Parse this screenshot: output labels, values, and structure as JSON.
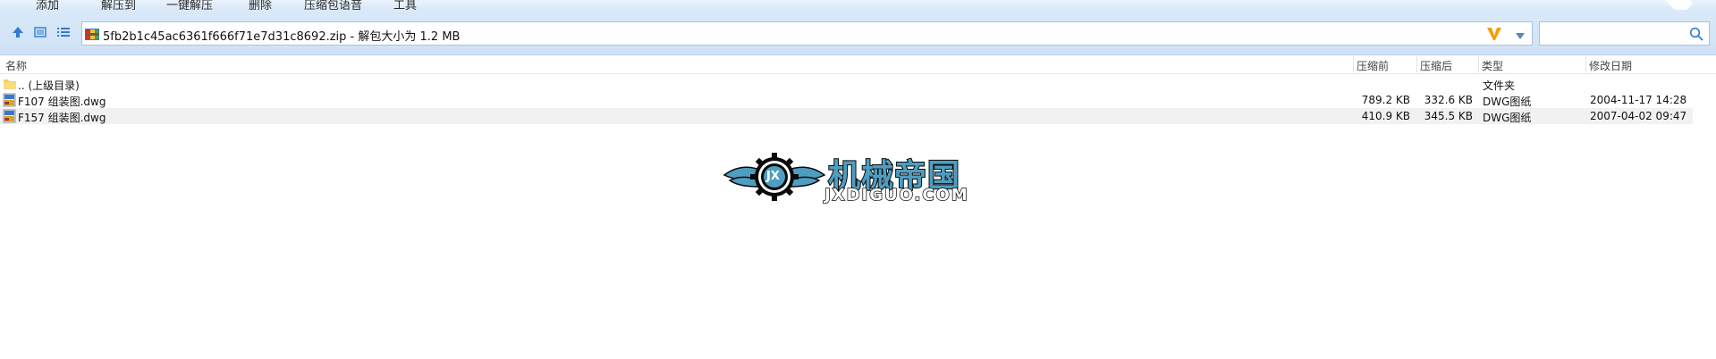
{
  "toolbar": {
    "items": [
      "添加",
      "解压到",
      "一键解压",
      "删除",
      "压缩包语音",
      "工具"
    ]
  },
  "address": {
    "path": "5fb2b1c45ac6361f666f71e7d31c8692.zip",
    "separator": " - ",
    "size_info": "解包大小为 1.2 MB"
  },
  "search": {
    "value": ""
  },
  "columns": {
    "name": "名称",
    "packed": "压缩前",
    "unpacked": "压缩后",
    "type": "类型",
    "modified": "修改日期"
  },
  "rows": [
    {
      "name": ".. (上级目录)",
      "packed": "",
      "unpacked": "",
      "type": "文件夹",
      "modified": ""
    },
    {
      "name": "F107 组装图.dwg",
      "packed": "789.2 KB",
      "unpacked": "332.6 KB",
      "type": "DWG图纸",
      "modified": "2004-11-17 14:28"
    },
    {
      "name": "F157 组装图.dwg",
      "packed": "410.9 KB",
      "unpacked": "345.5 KB",
      "type": "DWG图纸",
      "modified": "2007-04-02 09:47"
    }
  ],
  "watermark": {
    "cn": "机械帝国",
    "en": "JXDIGUO.COM",
    "emblem_text": "JX"
  },
  "colors": {
    "accent": "#2e7dd1",
    "toolbar_bg": "#d9e9f8",
    "selected_row": "#f1f1f1",
    "v_logo": "#f0a000"
  },
  "icons": [
    "up-arrow-icon",
    "detail-view-icon",
    "list-view-icon",
    "zip-archive-icon",
    "v-logo-icon",
    "dropdown-arrow-icon",
    "search-icon",
    "folder-icon",
    "dwg-file-icon"
  ]
}
